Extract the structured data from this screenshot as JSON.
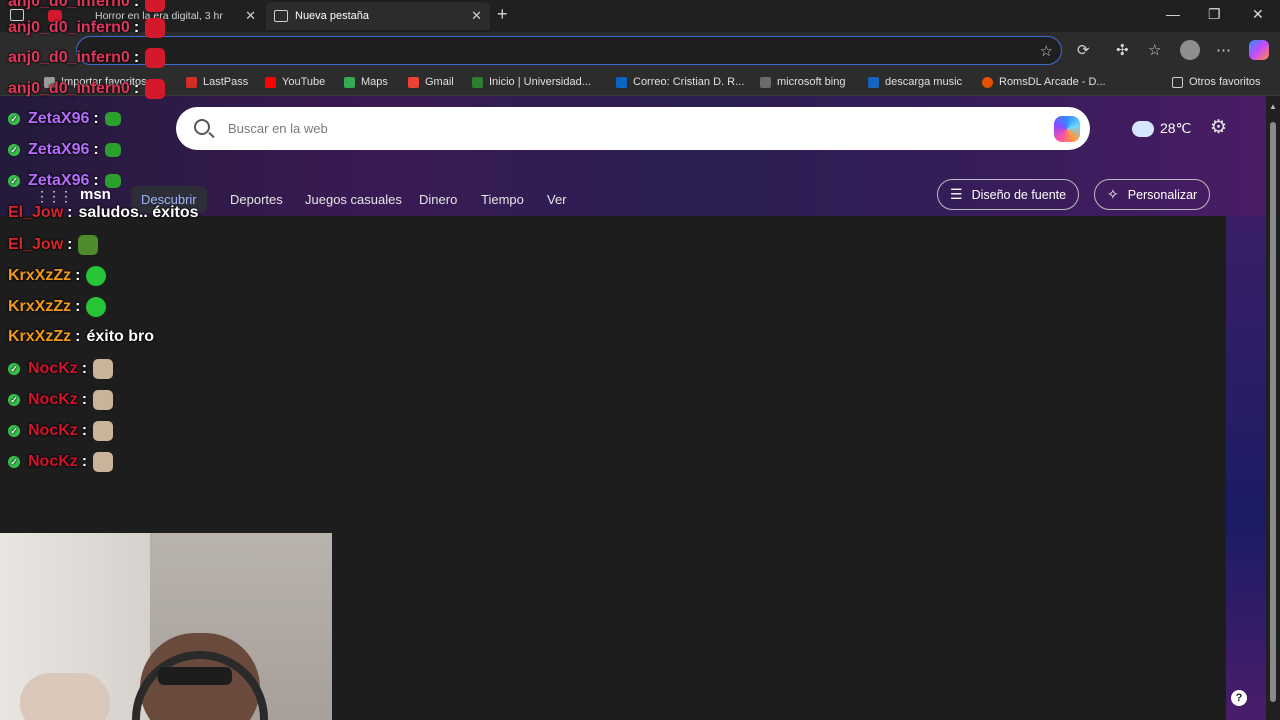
{
  "browser": {
    "tabs": [
      {
        "label": "Horror en la era digital, 3 hr",
        "active": false
      },
      {
        "label": "Nueva pestaña",
        "active": true
      }
    ],
    "new_tab_label": "+",
    "window_controls": {
      "minimize": "—",
      "restore": "❐",
      "close": "✕"
    },
    "omnibox_value": ""
  },
  "bookmarks": [
    {
      "label": "Importar favoritos",
      "color": "#9a9a9a"
    },
    {
      "label": "LastPass",
      "color": "#d32d27"
    },
    {
      "label": "YouTube",
      "color": "#ff0000"
    },
    {
      "label": "Maps",
      "color": "#34a853"
    },
    {
      "label": "Gmail",
      "color": "#ea4335"
    },
    {
      "label": "Inicio | Universidad...",
      "color": "#2e7d32"
    },
    {
      "label": "Correo: Cristian D. R...",
      "color": "#0a66c2"
    },
    {
      "label": "microsoft bing",
      "color": "#6b6b6b"
    },
    {
      "label": "descarga music",
      "color": "#1565c0"
    },
    {
      "label": "RomsDL Arcade - D...",
      "color": "#e65100"
    },
    {
      "label": "Otros favoritos",
      "color": "#9a9a9a"
    }
  ],
  "msn": {
    "search_placeholder": "Buscar en la web",
    "weather_temp": "28℃",
    "logo": "msn",
    "nav": [
      {
        "label": "Descubrir",
        "active": true
      },
      {
        "label": "Deportes",
        "active": false
      },
      {
        "label": "Juegos casuales",
        "active": false
      },
      {
        "label": "Dinero",
        "active": false
      },
      {
        "label": "Tiempo",
        "active": false
      },
      {
        "label": "Ver",
        "active": false
      }
    ],
    "font_button": "Diseño de fuente",
    "personalize_button": "Personalizar",
    "help": "?"
  },
  "chat": [
    {
      "user": "anj0_d0_infern0",
      "color": "#e0365a",
      "text": "",
      "emote": "#d4192c",
      "badge": false
    },
    {
      "user": "anj0_d0_infern0",
      "color": "#e0365a",
      "text": "",
      "emote": "#d4192c",
      "badge": false
    },
    {
      "user": "ZetaX96",
      "color": "#b56cff",
      "text": "",
      "emote": "#2ca02c",
      "badge": true
    },
    {
      "user": "ZetaX96",
      "color": "#b56cff",
      "text": "",
      "emote": "#2ca02c",
      "badge": true
    },
    {
      "user": "ZetaX96",
      "color": "#b56cff",
      "text": "",
      "emote": "#2ca02c",
      "badge": true
    },
    {
      "user": "El_Jow",
      "color": "#d9262b",
      "text": "saludos.. éxitos",
      "emote": "",
      "badge": false
    },
    {
      "user": "El_Jow",
      "color": "#d9262b",
      "text": "",
      "emote": "#4e8b2b",
      "badge": false
    },
    {
      "user": "KrxXzZz",
      "color": "#f29a1d",
      "text": "",
      "emote": "#27c436",
      "badge": false
    },
    {
      "user": "KrxXzZz",
      "color": "#f29a1d",
      "text": "",
      "emote": "#27c436",
      "badge": false
    },
    {
      "user": "KrxXzZz",
      "color": "#f29a1d",
      "text": "éxito bro",
      "emote": "",
      "badge": false
    },
    {
      "user": "NocKz",
      "color": "#d0142c",
      "text": "",
      "emote": "#c9b39a",
      "badge": true
    },
    {
      "user": "NocKz",
      "color": "#d0142c",
      "text": "",
      "emote": "#c9b39a",
      "badge": true
    },
    {
      "user": "NocKz",
      "color": "#d0142c",
      "text": "",
      "emote": "#c9b39a",
      "badge": true
    },
    {
      "user": "NocKz",
      "color": "#d0142c",
      "text": "",
      "emote": "#c9b39a",
      "badge": true
    }
  ]
}
